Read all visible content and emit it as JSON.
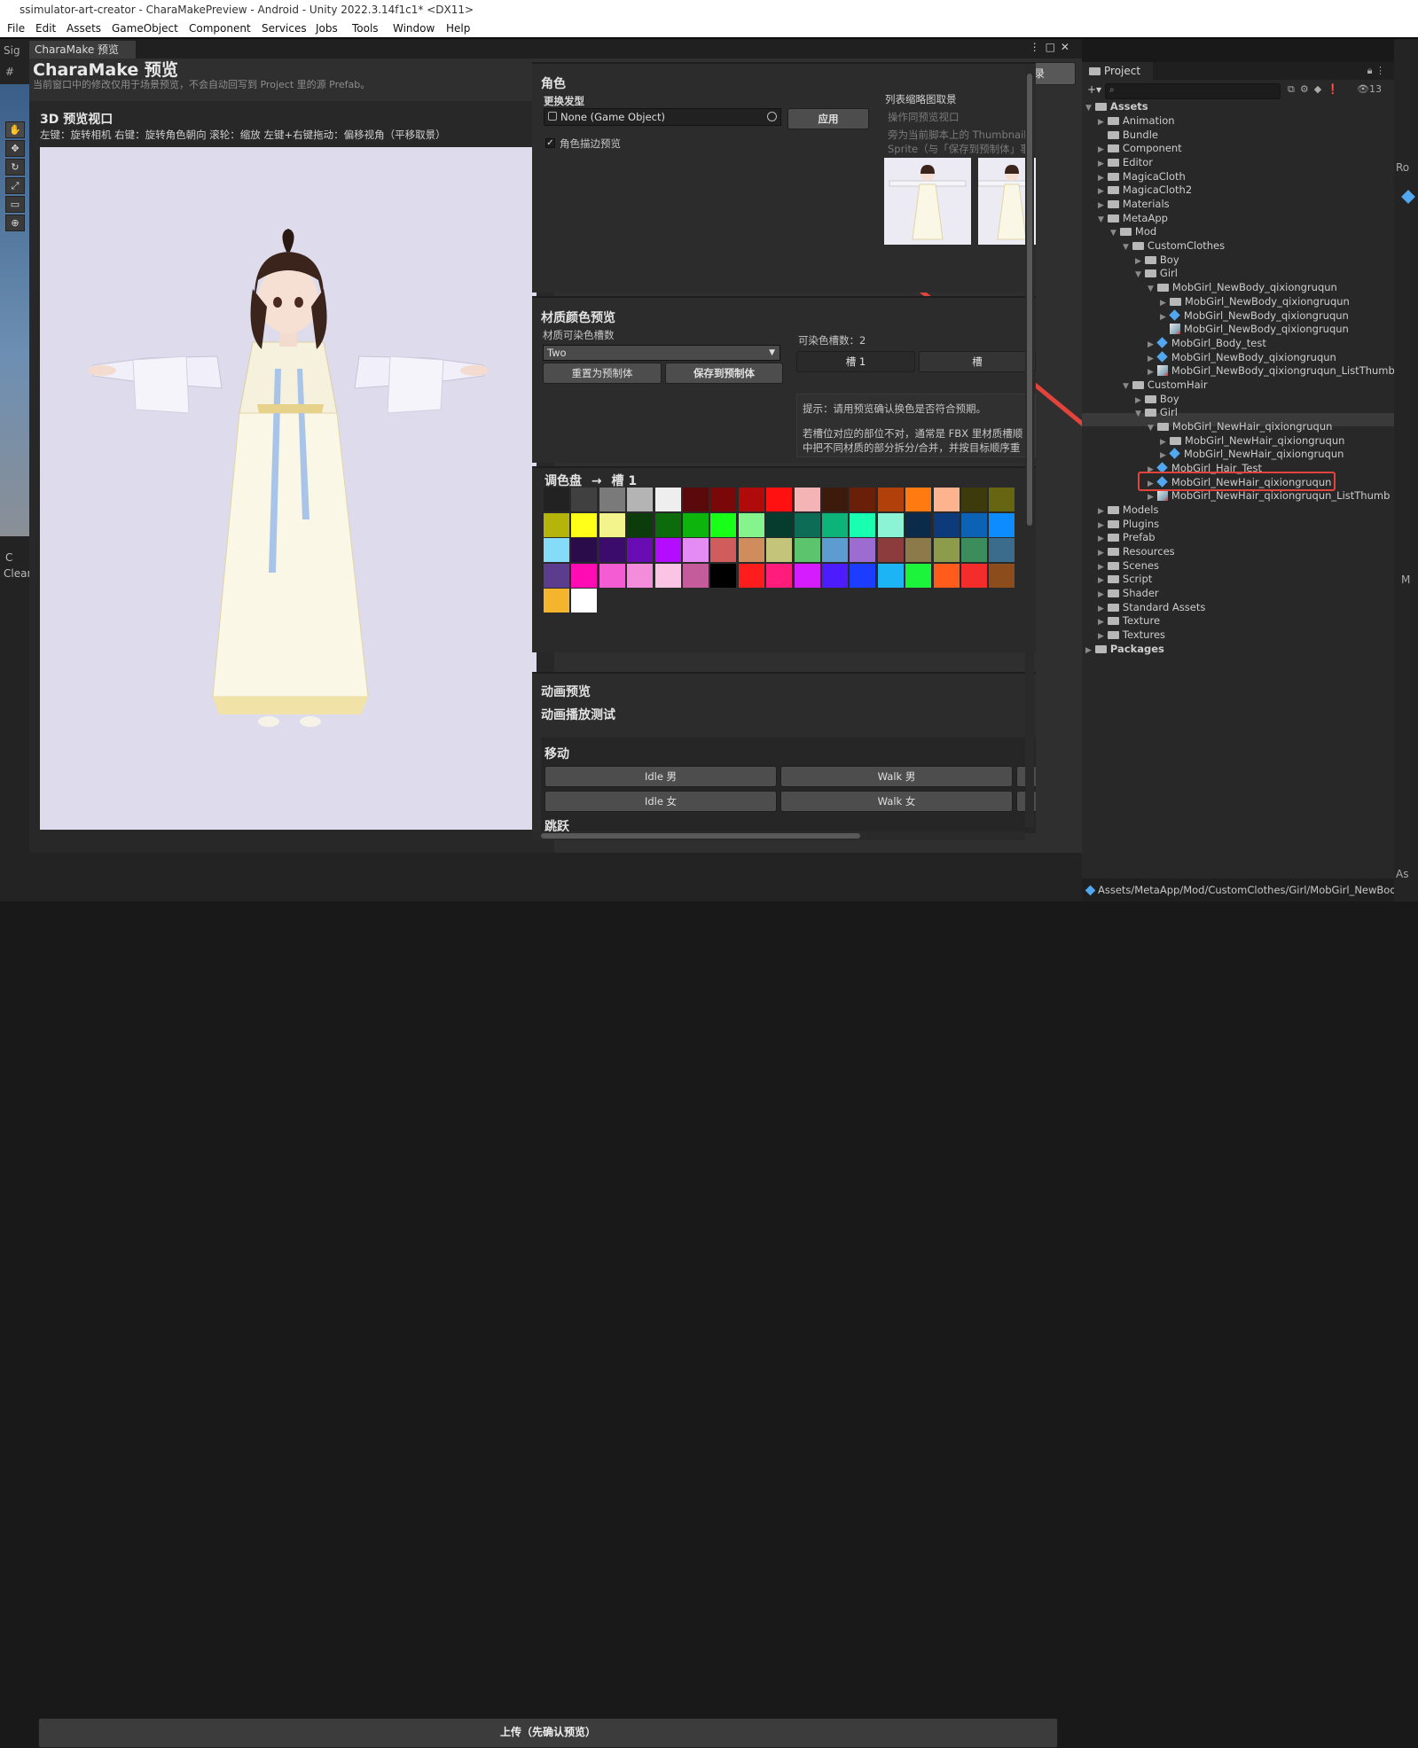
{
  "window": {
    "title": "ssimulator-art-creator - CharaMakePreview - Android - Unity 2022.3.14f1c1* <DX11>"
  },
  "menu": [
    "File",
    "Edit",
    "Assets",
    "GameObject",
    "Component",
    "Services",
    "Jobs",
    "Tools",
    "Window",
    "Help"
  ],
  "left": {
    "scene_tab": "Sig",
    "clear_label": "Clear",
    "c_label": "C"
  },
  "charamake": {
    "tab_label": "CharaMake 预览",
    "title": "CharaMake 预览",
    "subtitle": "当前窗口中的修改仅用于场景预览，不会自动回写到 Project 里的源 Prefab。",
    "login_label": "登录",
    "viewport": {
      "title": "3D 预览视口",
      "hint": "左键：旋转相机    右键：旋转角色朝向    滚轮：缩放    左键+右键拖动：偏移视角（平移取景）"
    },
    "character": {
      "title": "角色",
      "hair_label": "更换发型",
      "hair_value": "None (Game Object)",
      "apply_label": "应用",
      "outline_label": "角色描边预览",
      "outline_checked": true,
      "thumb_title": "列表缩略图取景",
      "thumb_hint1": "操作同预览视口",
      "thumb_hint2": "旁为当前脚本上的 Thumbnail",
      "thumb_hint3": "Sprite（与「保存到预制体」事"
    },
    "material": {
      "title": "材质颜色预览",
      "slot_count_label": "材质可染色槽数",
      "slot_count_value": "Two",
      "reset_label": "重置为预制体",
      "save_label": "保存到预制体",
      "dyeable_label": "可染色槽数：2",
      "slot1_label": "槽 1",
      "slot2_label": "槽",
      "tip1": "提示：请用预览确认换色是否符合预期。",
      "tip2": "若槽位对应的部位不对，通常是 FBX 里材质槽顺",
      "tip3": "中把不同材质的部分拆分/合并，并按目标顺序重"
    },
    "palette": {
      "title": "调色盘",
      "arrow": "→",
      "target": "槽 1",
      "colors": [
        "#222222",
        "#404040",
        "#7a7a7a",
        "#b4b4b4",
        "#eeeeee",
        "#5a0a0a",
        "#7a0808",
        "#b00a0a",
        "#ff1111",
        "#f4b4b6",
        "#3c1a0c",
        "#6a2008",
        "#b2400a",
        "#ff7a10",
        "#fdb48e",
        "#3d3a0c",
        "#666612",
        "#b4b40a",
        "#ffff18",
        "#f4f48c",
        "#0c3c0c",
        "#0c6c0c",
        "#0cb40c",
        "#18ff18",
        "#86f48c",
        "#063c2e",
        "#0c6c56",
        "#0cb47a",
        "#18ffb2",
        "#8cf4d4",
        "#0c2a4a",
        "#0c3a7a",
        "#0c62b4",
        "#0c8cff",
        "#84dcf8",
        "#2a0c4a",
        "#3c0c6c",
        "#6a0cb4",
        "#b40cff",
        "#e48cf4",
        "#d05c5c",
        "#d08c5c",
        "#c4c47a",
        "#5cc46c",
        "#5c9cd0",
        "#9c6cd0",
        "#8c3c3c",
        "#8c7a4a",
        "#8c9c4a",
        "#3c8c5c",
        "#3c6c8c",
        "#5c3c8c",
        "#ff0cb4",
        "#f45cd4",
        "#f48cdc",
        "#fcc4e4",
        "#c45c9c",
        "#000000",
        "#ff1c1c",
        "#ff1c7a",
        "#d41cff",
        "#4c1cff",
        "#1c3cff",
        "#1cb4f4",
        "#1cf43c",
        "#ff5c1c",
        "#f42c2c",
        "#8c4c1c",
        "#f4b42c",
        "#ffffff"
      ]
    },
    "animation": {
      "title": "动画预览",
      "subtitle": "动画播放测试",
      "move_label": "移动",
      "idle_male": "Idle 男",
      "walk_male": "Walk 男",
      "idle_female": "Idle 女",
      "walk_female": "Walk 女",
      "jump_label": "跳跃"
    },
    "upload_label": "上传（先确认预览）"
  },
  "project": {
    "tab_label": "Project",
    "hidden_count": "13",
    "path": "Assets/MetaApp/Mod/CustomClothes/Girl/MobGirl_NewBody_qixiongruqun",
    "packages_label": "Packages",
    "assets_label": "Assets",
    "tree": [
      {
        "label": "Animation",
        "icon": "folder",
        "depth": 1,
        "arrow": true
      },
      {
        "label": "Bundle",
        "icon": "folder",
        "depth": 1,
        "arrow": false
      },
      {
        "label": "Component",
        "icon": "folder",
        "depth": 1,
        "arrow": true
      },
      {
        "label": "Editor",
        "icon": "folder",
        "depth": 1,
        "arrow": true
      },
      {
        "label": "MagicaCloth",
        "icon": "folder",
        "depth": 1,
        "arrow": true
      },
      {
        "label": "MagicaCloth2",
        "icon": "folder",
        "depth": 1,
        "arrow": true
      },
      {
        "label": "Materials",
        "icon": "folder",
        "depth": 1,
        "arrow": true
      },
      {
        "label": "MetaApp",
        "icon": "folder",
        "depth": 1,
        "arrow": "open"
      },
      {
        "label": "Mod",
        "icon": "folder",
        "depth": 2,
        "arrow": "open"
      },
      {
        "label": "CustomClothes",
        "icon": "folder",
        "depth": 3,
        "arrow": "open"
      },
      {
        "label": "Boy",
        "icon": "folder",
        "depth": 4,
        "arrow": true
      },
      {
        "label": "Girl",
        "icon": "folder",
        "depth": 4,
        "arrow": "open"
      },
      {
        "label": "MobGirl_NewBody_qixiongruqun",
        "icon": "folder",
        "depth": 5,
        "arrow": "open"
      },
      {
        "label": "MobGirl_NewBody_qixiongruqun",
        "icon": "folder",
        "depth": 6,
        "arrow": true
      },
      {
        "label": "MobGirl_NewBody_qixiongruqun",
        "icon": "prefab",
        "depth": 6,
        "arrow": true
      },
      {
        "label": "MobGirl_NewBody_qixiongruqun",
        "icon": "image",
        "depth": 6,
        "arrow": false
      },
      {
        "label": "MobGirl_Body_test",
        "icon": "prefab",
        "depth": 5,
        "arrow": true
      },
      {
        "label": "MobGirl_NewBody_qixiongruqun",
        "icon": "prefab",
        "depth": 5,
        "arrow": true
      },
      {
        "label": "MobGirl_NewBody_qixiongruqun_ListThumb",
        "icon": "image",
        "depth": 5,
        "arrow": true
      },
      {
        "label": "CustomHair",
        "icon": "folder",
        "depth": 3,
        "arrow": "open"
      },
      {
        "label": "Boy",
        "icon": "folder",
        "depth": 4,
        "arrow": true
      },
      {
        "label": "Girl",
        "icon": "folder",
        "depth": 4,
        "arrow": "open"
      },
      {
        "label": "MobGirl_NewHair_qixiongruqun",
        "icon": "folder",
        "depth": 5,
        "arrow": "open"
      },
      {
        "label": "MobGirl_NewHair_qixiongruqun",
        "icon": "folder",
        "depth": 6,
        "arrow": true
      },
      {
        "label": "MobGirl_NewHair_qixiongruqun",
        "icon": "prefab",
        "depth": 6,
        "arrow": true
      },
      {
        "label": "MobGirl_Hair_Test",
        "icon": "prefab",
        "depth": 5,
        "arrow": true
      },
      {
        "label": "MobGirl_NewHair_qixiongruqun",
        "icon": "prefab",
        "depth": 5,
        "arrow": true
      },
      {
        "label": "MobGirl_NewHair_qixiongruqun_ListThumb",
        "icon": "image",
        "depth": 5,
        "arrow": true
      },
      {
        "label": "Models",
        "icon": "folder",
        "depth": 1,
        "arrow": true
      },
      {
        "label": "Plugins",
        "icon": "folder",
        "depth": 1,
        "arrow": true
      },
      {
        "label": "Prefab",
        "icon": "folder",
        "depth": 1,
        "arrow": true
      },
      {
        "label": "Resources",
        "icon": "folder",
        "depth": 1,
        "arrow": true
      },
      {
        "label": "Scenes",
        "icon": "folder",
        "depth": 1,
        "arrow": true
      },
      {
        "label": "Script",
        "icon": "folder",
        "depth": 1,
        "arrow": true
      },
      {
        "label": "Shader",
        "icon": "folder",
        "depth": 1,
        "arrow": true
      },
      {
        "label": "Standard Assets",
        "icon": "folder",
        "depth": 1,
        "arrow": true
      },
      {
        "label": "Texture",
        "icon": "folder",
        "depth": 1,
        "arrow": true
      },
      {
        "label": "Textures",
        "icon": "folder",
        "depth": 1,
        "arrow": true
      }
    ]
  },
  "right_edge": {
    "ro": "Ro",
    "m": "M",
    "as": "As"
  },
  "colors": {
    "annotation_red": "#e2433b",
    "selection_bg": "#3a3a3a",
    "prefab_blue": "#51a8f0"
  }
}
